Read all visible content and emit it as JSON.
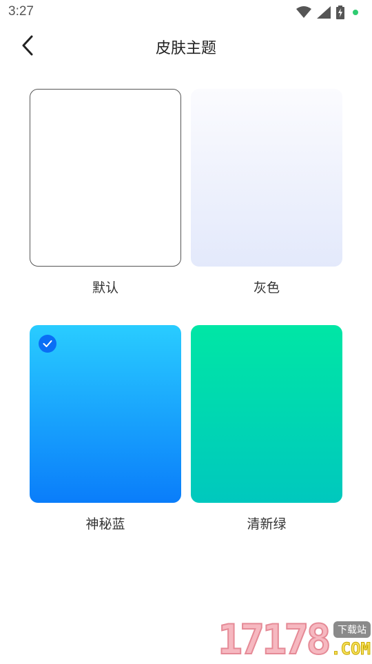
{
  "status_bar": {
    "time": "3:27",
    "icons": [
      "wifi-icon",
      "cell-signal-icon",
      "battery-charging-icon",
      "notification-dot-icon"
    ]
  },
  "header": {
    "back_icon": "chevron-left-icon",
    "title": "皮肤主题"
  },
  "themes": [
    {
      "label": "默认",
      "selected": false,
      "colors": [
        "#ffffff"
      ]
    },
    {
      "label": "灰色",
      "selected": false,
      "colors": [
        "#fbfbfe",
        "#e3e9fb"
      ]
    },
    {
      "label": "神秘蓝",
      "selected": true,
      "colors": [
        "#29ccff",
        "#0a7dfa"
      ]
    },
    {
      "label": "清新绿",
      "selected": false,
      "colors": [
        "#00e6a5",
        "#00c8be"
      ]
    }
  ],
  "watermark": {
    "number": "17178",
    "badge": "下载站",
    "suffix": ".COM"
  }
}
